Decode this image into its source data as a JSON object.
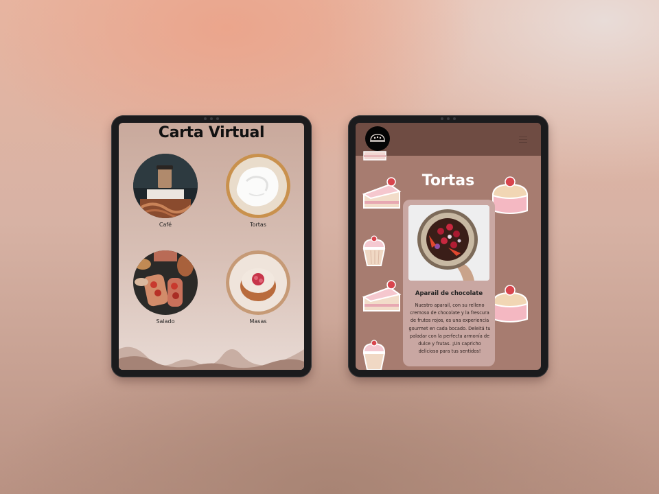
{
  "left_tablet": {
    "title": "Carta Virtual",
    "categories": [
      {
        "label": "Café",
        "icon": "coffee-photo"
      },
      {
        "label": "Tortas",
        "icon": "cream-cake-photo"
      },
      {
        "label": "Salado",
        "icon": "bruschetta-photo"
      },
      {
        "label": "Masas",
        "icon": "pastry-photo"
      }
    ]
  },
  "right_tablet": {
    "header": {
      "logo_icon": "cake-logo-icon",
      "menu_icon": "hamburger-menu-icon"
    },
    "page_title": "Tortas",
    "product": {
      "name": "Aparail de chocolate",
      "description": "Nuestro aparail, con su relleno cremoso de chocolate y la frescura de frutos rojos, es una experiencia gourmet en cada bocado. Deleitá tu paladar con la perfecta armonía de dulce y frutas. ¡Un capricho delicioso para tus sentidos!",
      "image_icon": "chocolate-tart-photo"
    }
  },
  "colors": {
    "header_brown": "#6f4c43",
    "page_background": "#a77c70",
    "card_background": "#c9a7a2"
  }
}
